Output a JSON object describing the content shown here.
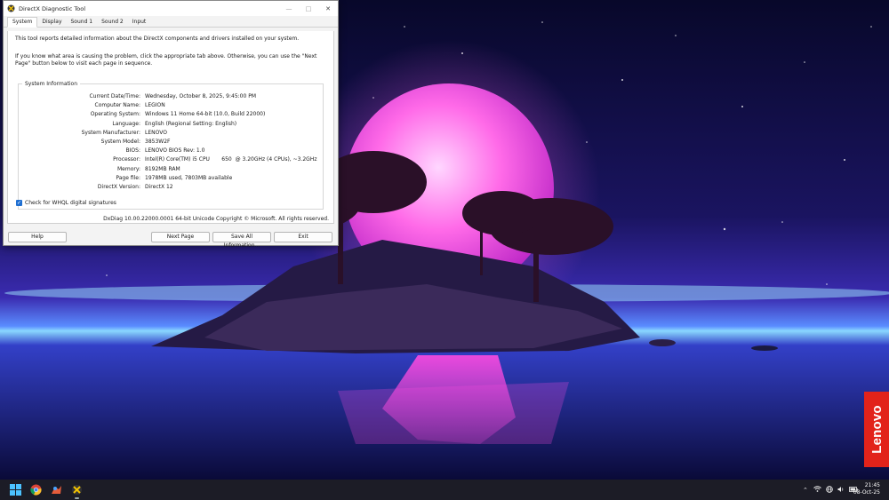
{
  "window": {
    "title": "DirectX Diagnostic Tool",
    "tabs": [
      {
        "label": "System",
        "active": true
      },
      {
        "label": "Display",
        "active": false
      },
      {
        "label": "Sound 1",
        "active": false
      },
      {
        "label": "Sound 2",
        "active": false
      },
      {
        "label": "Input",
        "active": false
      }
    ],
    "intro_line1": "This tool reports detailed information about the DirectX components and drivers installed on your system.",
    "intro_line2": "If you know what area is causing the problem, click the appropriate tab above.  Otherwise, you can use the \"Next Page\" button below to visit each page in sequence.",
    "system_info": {
      "legend": "System Information",
      "rows": [
        {
          "label": "Current Date/Time:",
          "value": "Wednesday, October 8, 2025, 9:45:00 PM"
        },
        {
          "label": "Computer Name:",
          "value": "LEGION"
        },
        {
          "label": "Operating System:",
          "value": "Windows 11 Home 64-bit (10.0, Build 22000)"
        },
        {
          "label": "Language:",
          "value": "English (Regional Setting: English)"
        },
        {
          "label": "System Manufacturer:",
          "value": "LENOVO"
        },
        {
          "label": "System Model:",
          "value": "3853W2F"
        },
        {
          "label": "BIOS:",
          "value": "LENOVO BIOS Rev: 1.0"
        },
        {
          "label": "Processor:",
          "value": "Intel(R) Core(TM) i5 CPU       650  @ 3.20GHz (4 CPUs), ~3.2GHz"
        },
        {
          "label": "Memory:",
          "value": "8192MB RAM"
        },
        {
          "label": "Page file:",
          "value": "1978MB used, 7803MB available"
        },
        {
          "label": "DirectX Version:",
          "value": "DirectX 12"
        }
      ]
    },
    "whql_label": "Check for WHQL digital signatures",
    "whql_checked": true,
    "version_line": "DxDiag 10.00.22000.0001 64-bit Unicode  Copyright © Microsoft. All rights reserved.",
    "buttons": {
      "help": "Help",
      "next_page": "Next Page",
      "save_all": "Save All Information...",
      "exit": "Exit"
    }
  },
  "desktop": {
    "badge_text": "Lenovo",
    "badge_color": "#e2231a"
  },
  "taskbar": {
    "pinned": [
      "windows-start-icon",
      "chrome-icon",
      "paint-app-icon",
      "dxdiag-icon"
    ],
    "tray_icons": [
      "chevron-up-icon",
      "wifi-icon",
      "globe-icon",
      "speaker-icon",
      "battery-icon"
    ],
    "time": "21:45",
    "date": "08-Oct-25"
  }
}
